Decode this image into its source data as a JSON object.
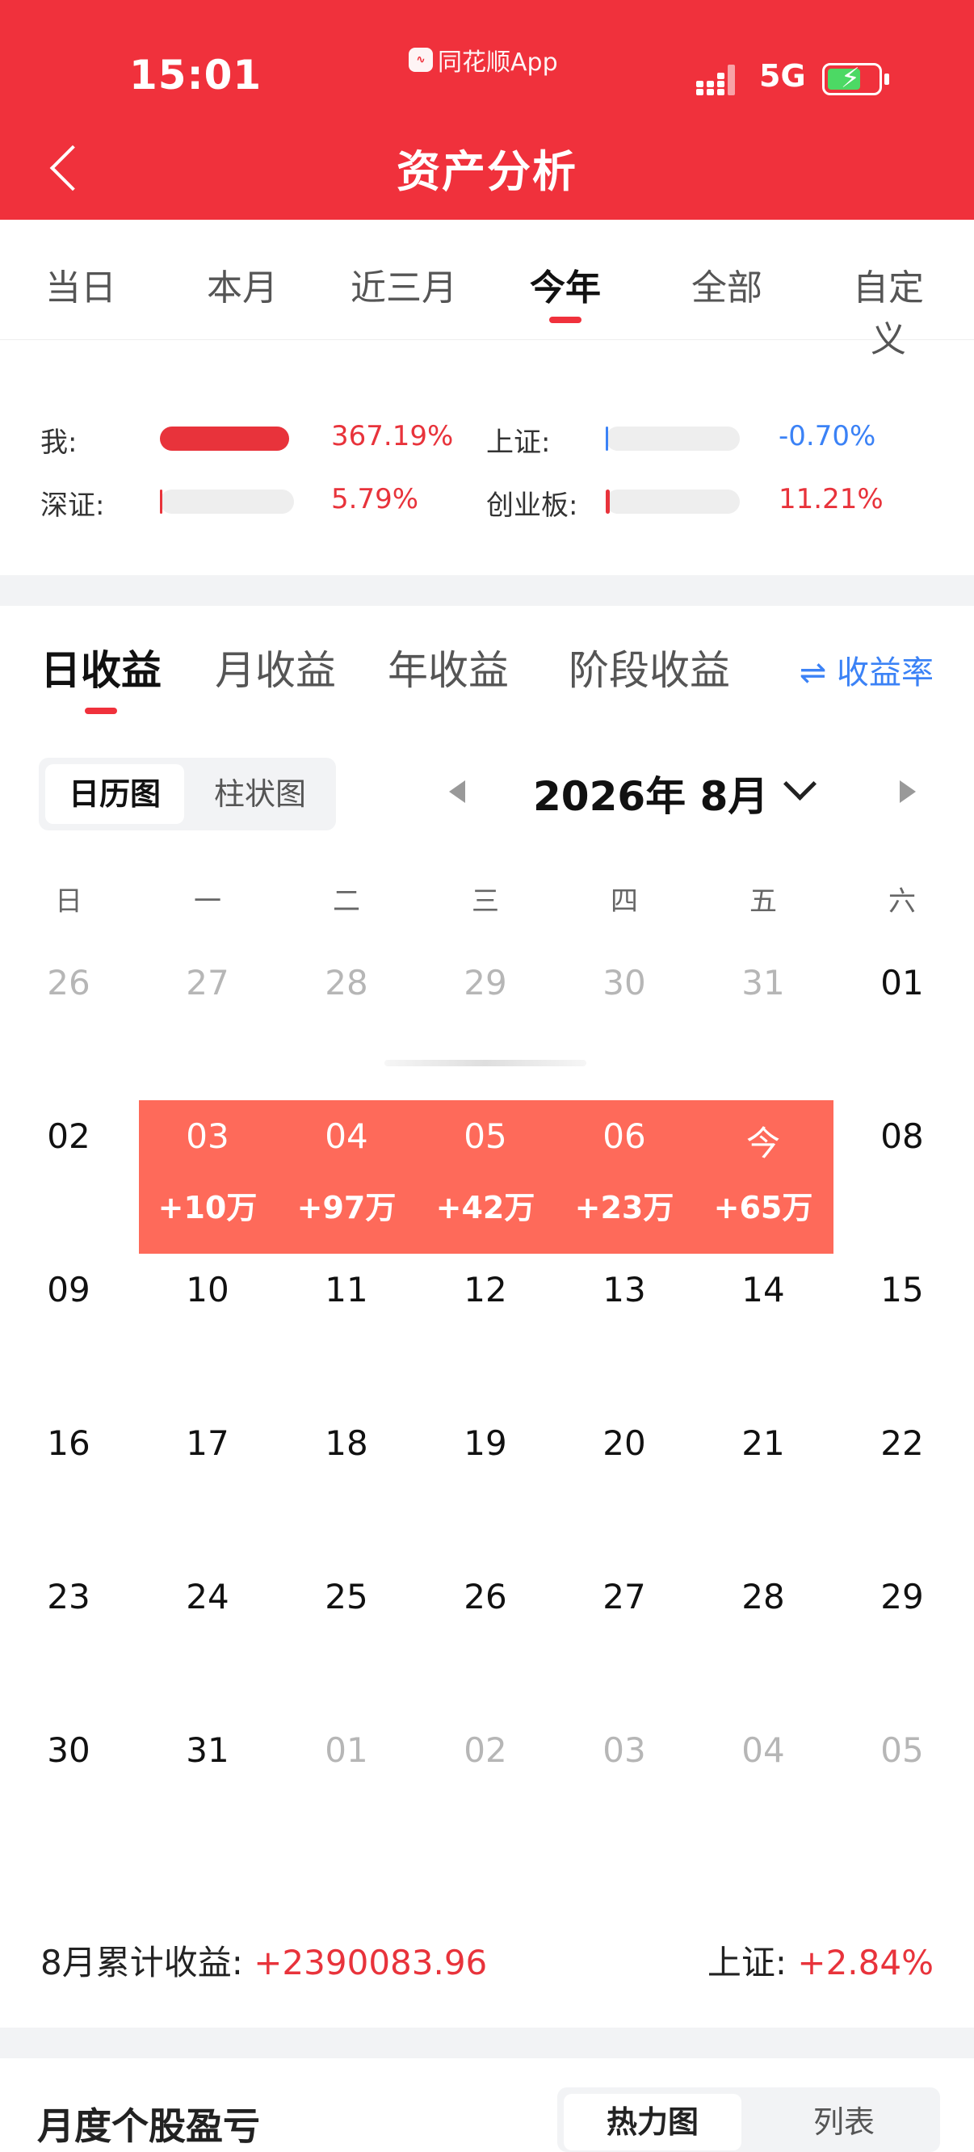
{
  "status": {
    "time": "15:01",
    "app_label": "同花顺App",
    "network": "5G"
  },
  "header": {
    "title": "资产分析"
  },
  "period_tabs": [
    "当日",
    "本月",
    "近三月",
    "今年",
    "全部",
    "自定义"
  ],
  "compare": [
    {
      "label": "我:",
      "value": "367.19%",
      "fill": 1.0,
      "tone": "red"
    },
    {
      "label": "上证:",
      "value": "-0.70%",
      "fill": 0.01,
      "tone": "blue"
    },
    {
      "label": "深证:",
      "value": "5.79%",
      "fill": 0.02,
      "tone": "red"
    },
    {
      "label": "创业板:",
      "value": "11.21%",
      "fill": 0.03,
      "tone": "red"
    }
  ],
  "income_tabs": [
    "日收益",
    "月收益",
    "年收益",
    "阶段收益"
  ],
  "rate_link": "⇌ 收益率",
  "view_toggle": [
    "日历图",
    "柱状图"
  ],
  "month_label": "2026年 8月",
  "weekdays": [
    "日",
    "一",
    "二",
    "三",
    "四",
    "五",
    "六"
  ],
  "weeks": [
    [
      {
        "d": "26",
        "t": "grey"
      },
      {
        "d": "27",
        "t": "grey"
      },
      {
        "d": "28",
        "t": "grey"
      },
      {
        "d": "29",
        "t": "grey"
      },
      {
        "d": "30",
        "t": "grey"
      },
      {
        "d": "31",
        "t": "grey"
      },
      {
        "d": "01",
        "t": "black"
      }
    ],
    [
      {
        "d": "02",
        "t": "black"
      },
      {
        "d": "03",
        "t": "onred",
        "g": "+10万"
      },
      {
        "d": "04",
        "t": "onred",
        "g": "+97万"
      },
      {
        "d": "05",
        "t": "onred",
        "g": "+42万"
      },
      {
        "d": "06",
        "t": "onred",
        "g": "+23万"
      },
      {
        "d": "今",
        "t": "onred",
        "g": "+65万"
      },
      {
        "d": "08",
        "t": "black"
      }
    ],
    [
      {
        "d": "09",
        "t": "black"
      },
      {
        "d": "10",
        "t": "black"
      },
      {
        "d": "11",
        "t": "black"
      },
      {
        "d": "12",
        "t": "black"
      },
      {
        "d": "13",
        "t": "black"
      },
      {
        "d": "14",
        "t": "black"
      },
      {
        "d": "15",
        "t": "black"
      }
    ],
    [
      {
        "d": "16",
        "t": "black"
      },
      {
        "d": "17",
        "t": "black"
      },
      {
        "d": "18",
        "t": "black"
      },
      {
        "d": "19",
        "t": "black"
      },
      {
        "d": "20",
        "t": "black"
      },
      {
        "d": "21",
        "t": "black"
      },
      {
        "d": "22",
        "t": "black"
      }
    ],
    [
      {
        "d": "23",
        "t": "black"
      },
      {
        "d": "24",
        "t": "black"
      },
      {
        "d": "25",
        "t": "black"
      },
      {
        "d": "26",
        "t": "black"
      },
      {
        "d": "27",
        "t": "black"
      },
      {
        "d": "28",
        "t": "black"
      },
      {
        "d": "29",
        "t": "black"
      }
    ],
    [
      {
        "d": "30",
        "t": "black"
      },
      {
        "d": "31",
        "t": "black"
      },
      {
        "d": "01",
        "t": "grey"
      },
      {
        "d": "02",
        "t": "grey"
      },
      {
        "d": "03",
        "t": "grey"
      },
      {
        "d": "04",
        "t": "grey"
      },
      {
        "d": "05",
        "t": "grey"
      }
    ]
  ],
  "summary": {
    "left_label": "8月累计收益:",
    "left_value": "+2390083.96",
    "right_label": "上证:",
    "right_value": "+2.84%"
  },
  "bottom": {
    "title": "月度个股盈亏",
    "seg1": "热力图",
    "seg2": "列表"
  },
  "colors": {
    "brand_red": "#f0313c",
    "gain_band": "#fe6a5a",
    "link_blue": "#3b82f6"
  }
}
